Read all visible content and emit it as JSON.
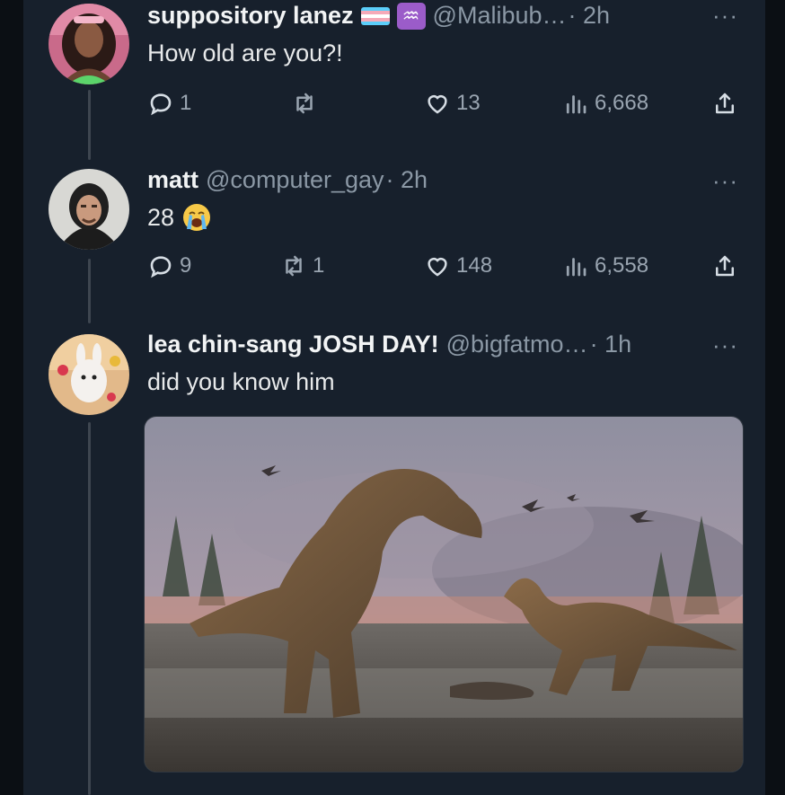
{
  "tweets": [
    {
      "name": "suppository lanez",
      "handle": "@Malibub…",
      "time": "· 2h",
      "more": "···",
      "text": "How old are you?!",
      "replies": "1",
      "retweets": "",
      "likes": "13",
      "views": "6,668"
    },
    {
      "name": "matt",
      "handle": "@computer_gay",
      "time": "· 2h",
      "more": "···",
      "text": "28",
      "replies": "9",
      "retweets": "1",
      "likes": "148",
      "views": "6,558"
    },
    {
      "name": "lea chin-sang JOSH DAY!",
      "handle": "@bigfatmo…",
      "time": "· 1h",
      "more": "···",
      "text": "did you know him"
    }
  ],
  "colors": {
    "background": "#17202c",
    "text": "#e7e9ea",
    "muted": "#8b98a5",
    "thread_line": "#3e4650"
  },
  "icons": [
    "reply-icon",
    "retweet-icon",
    "like-icon",
    "views-icon",
    "share-icon",
    "more-icon"
  ]
}
